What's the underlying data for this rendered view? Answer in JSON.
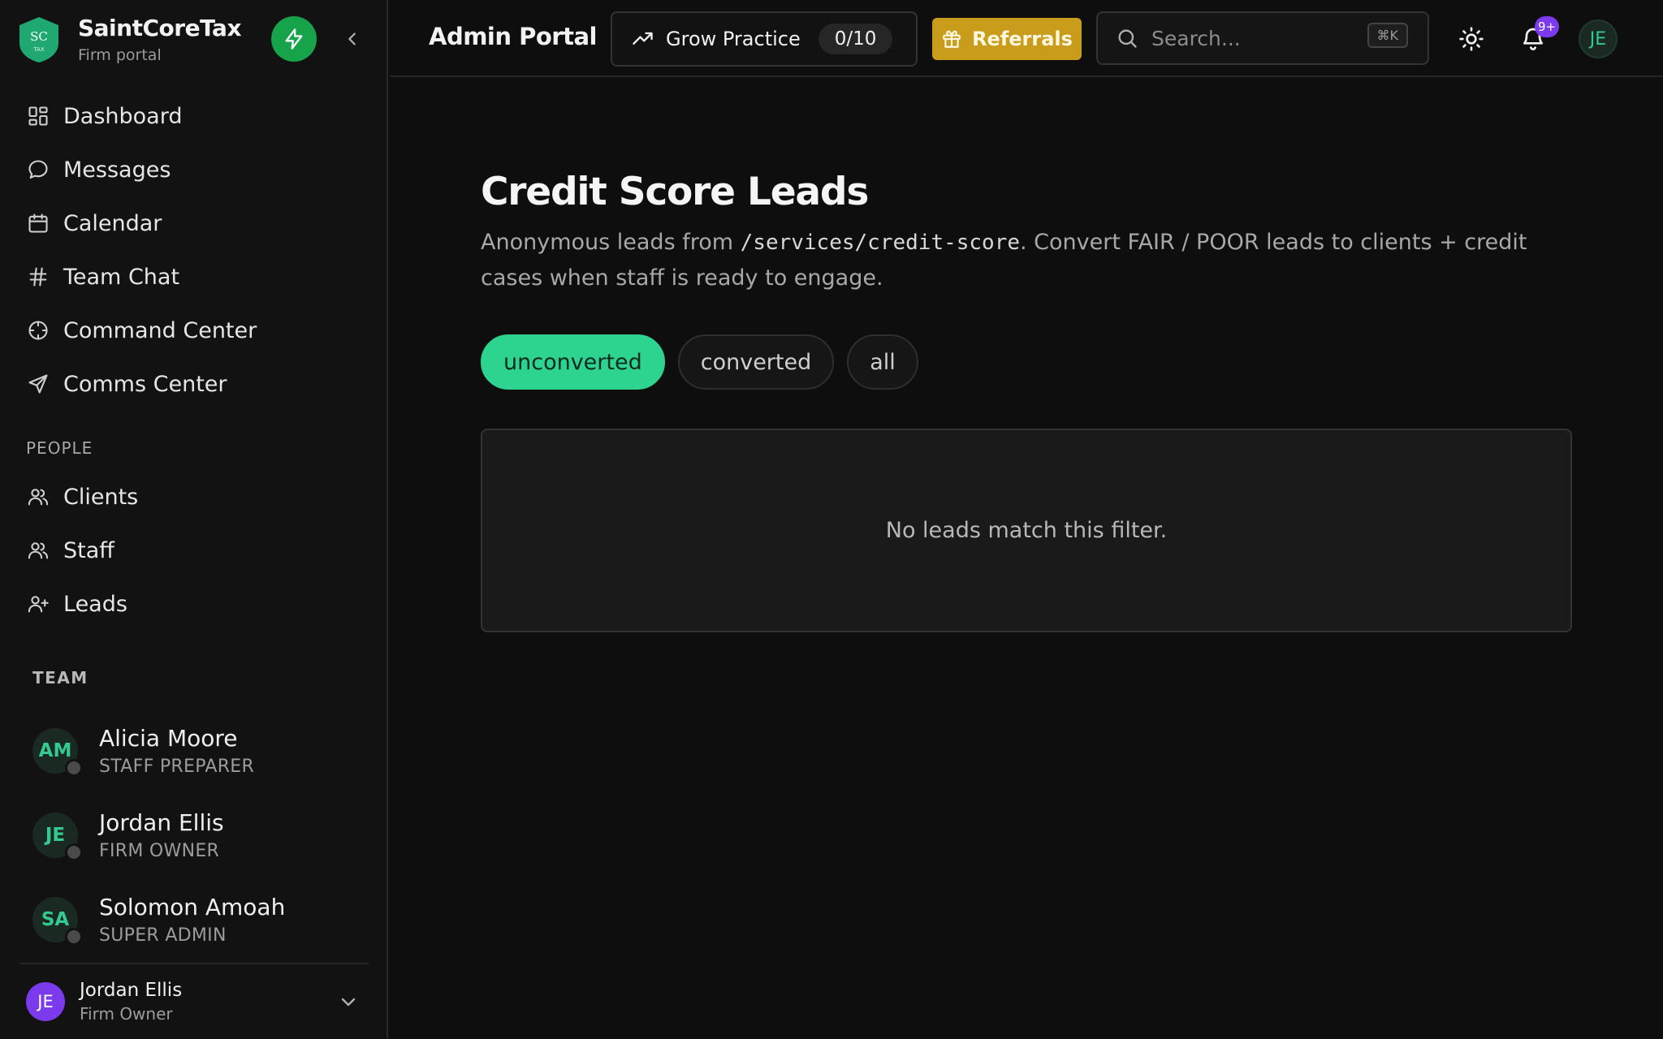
{
  "brand": {
    "name": "SaintCoreTax",
    "subtitle": "Firm portal",
    "logo_text": "SC",
    "logo_sub": "TAX"
  },
  "sidebar": {
    "nav": [
      {
        "label": "Dashboard",
        "icon": "dashboard-icon"
      },
      {
        "label": "Messages",
        "icon": "message-icon"
      },
      {
        "label": "Calendar",
        "icon": "calendar-icon"
      },
      {
        "label": "Team Chat",
        "icon": "hash-icon"
      },
      {
        "label": "Command Center",
        "icon": "crosshair-icon"
      },
      {
        "label": "Comms Center",
        "icon": "send-icon"
      }
    ],
    "people_title": "PEOPLE",
    "people": [
      {
        "label": "Clients",
        "icon": "users-icon"
      },
      {
        "label": "Staff",
        "icon": "users-icon"
      },
      {
        "label": "Leads",
        "icon": "user-plus-icon"
      }
    ],
    "team_title": "TEAM",
    "team": [
      {
        "initials": "AM",
        "name": "Alicia Moore",
        "role": "STAFF PREPARER"
      },
      {
        "initials": "JE",
        "name": "Jordan Ellis",
        "role": "FIRM OWNER"
      },
      {
        "initials": "SA",
        "name": "Solomon Amoah",
        "role": "SUPER ADMIN"
      }
    ],
    "user": {
      "initials": "JE",
      "name": "Jordan Ellis",
      "role": "Firm Owner"
    }
  },
  "topbar": {
    "title": "Admin Portal",
    "grow_label": "Grow Practice",
    "grow_count": "0/10",
    "referrals_label": "Referrals",
    "search_placeholder": "Search...",
    "search_shortcut": "⌘K",
    "notification_badge": "9+",
    "avatar_initials": "JE"
  },
  "main": {
    "title": "Credit Score Leads",
    "desc_prefix": "Anonymous leads from ",
    "desc_path": "/services/credit-score",
    "desc_suffix": ". Convert FAIR / POOR leads to clients + credit cases when staff is ready to engage.",
    "filters": [
      {
        "label": "unconverted",
        "active": true
      },
      {
        "label": "converted",
        "active": false
      },
      {
        "label": "all",
        "active": false
      }
    ],
    "empty_message": "No leads match this filter."
  },
  "colors": {
    "accent": "#2dd48f",
    "bolt": "#17a34a",
    "referrals": "#c99c1c",
    "badge": "#7c3aed"
  }
}
